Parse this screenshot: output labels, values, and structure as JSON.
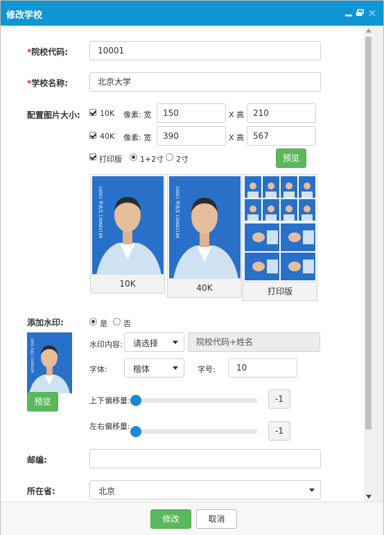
{
  "window": {
    "title": "修改学校",
    "controls": [
      "minimize-icon",
      "restore-icon",
      "close-icon"
    ]
  },
  "colors": {
    "titlebar": "#0f95d3",
    "primary_button": "#5cb85c",
    "required_star": "#e02020",
    "slider_handle": "#1a8ad4",
    "photo_background": "#2970c9"
  },
  "form": {
    "school_code": {
      "star": "*",
      "label": "院校代码:",
      "value": "10001"
    },
    "school_name": {
      "star": "*",
      "label": "学校名称:",
      "value": "北京大学"
    },
    "image_size": {
      "label": "配置图片大小:",
      "rows": [
        {
          "checked": true,
          "name": "10K",
          "pixel_label": "像素: 宽",
          "width": "150",
          "x_label": "X 高",
          "height": "210"
        },
        {
          "checked": true,
          "name": "40K",
          "pixel_label": "像素: 宽",
          "width": "390",
          "x_label": "X 高",
          "height": "567"
        }
      ],
      "print": {
        "checked": true,
        "label": "打印版",
        "options": [
          {
            "label": "1+2寸",
            "selected": true
          },
          {
            "label": "2寸",
            "selected": false
          }
        ]
      },
      "preview_button": "预览",
      "preview_cards": [
        {
          "caption": "10K"
        },
        {
          "caption": "40K"
        },
        {
          "caption": "打印版"
        }
      ],
      "photo_sidebar_text": "10001 华北汉 130682199"
    },
    "watermark": {
      "label": "添加水印:",
      "options": [
        {
          "label": "是",
          "selected": true
        },
        {
          "label": "否",
          "selected": false
        }
      ],
      "content_label": "水印内容:",
      "content_select": "请选择",
      "content_value": "院校代码+姓名",
      "font_label": "字体:",
      "font_select": "楷体",
      "size_label": "字号:",
      "size_value": "10",
      "vertical_label": "上下偏移量:",
      "vertical_value": "-1",
      "horizontal_label": "左右偏移量:",
      "horizontal_value": "-1",
      "preview_button": "预览"
    },
    "postcode": {
      "label": "邮编:",
      "value": ""
    },
    "province": {
      "label": "所在省:",
      "value": "北京"
    }
  },
  "footer": {
    "submit": "修改",
    "cancel": "取消"
  }
}
